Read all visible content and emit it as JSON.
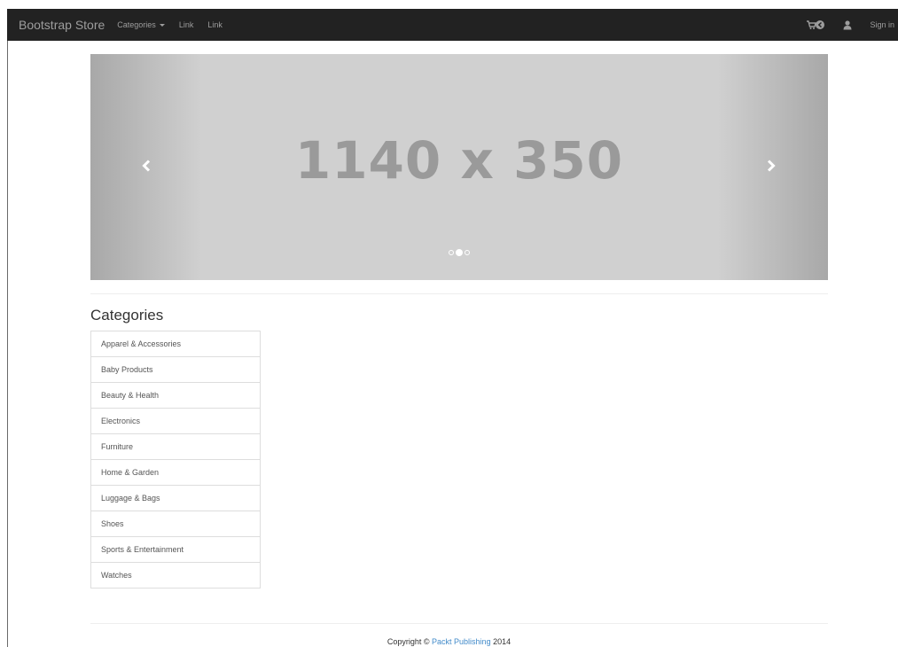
{
  "navbar": {
    "brand": "Bootstrap Store",
    "links": [
      "Categories",
      "Link",
      "Link"
    ],
    "sign_in": "Sign in",
    "icons": [
      "shopping-cart-icon",
      "user-icon"
    ]
  },
  "carousel": {
    "placeholder_text": "1140 x 350",
    "slide_count": 3,
    "active_slide": 2
  },
  "categories": {
    "heading": "Categories",
    "items": [
      "Apparel & Accessories",
      "Baby Products",
      "Beauty & Health",
      "Electronics",
      "Furniture",
      "Home & Garden",
      "Luggage & Bags",
      "Shoes",
      "Sports & Entertainment",
      "Watches"
    ]
  },
  "footer": {
    "prefix": "Copyright © ",
    "link_text": "Packt Publishing",
    "suffix": " 2014"
  },
  "colors": {
    "navbar_bg": "#222222",
    "navbar_text": "#9d9d9d",
    "link_blue": "#428bca",
    "carousel_bg": "#d0d0d0"
  }
}
